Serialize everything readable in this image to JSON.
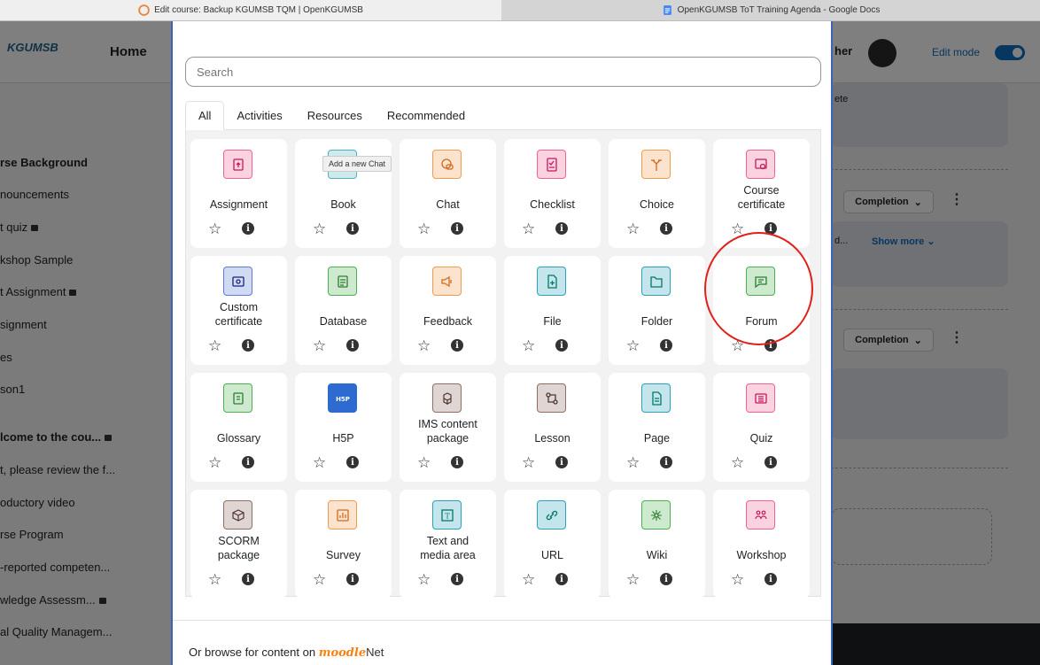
{
  "browser": {
    "tab1_title": "Edit course: Backup KGUMSB TQM | OpenKGUMSB",
    "tab2_title": "OpenKGUMSB ToT Training Agenda - Google Docs"
  },
  "navbar": {
    "logo": "KGUMSB",
    "home": "Home",
    "user_fragment": "her",
    "edit_mode_label": "Edit mode"
  },
  "sidebar": {
    "items": [
      "rse Background",
      "nouncements",
      "t quiz",
      "kshop Sample",
      "t Assignment",
      "signment",
      "es",
      "son1",
      "lcome to the cou...",
      "t, please review the f...",
      "oductory video",
      "rse Program",
      "-reported competen...",
      "wledge Assessm...",
      "al Quality Managem..."
    ]
  },
  "right": {
    "box1_text": "ete",
    "completion_label": "Completion",
    "truncated": "d...",
    "show_more": "Show more"
  },
  "modal": {
    "search_placeholder": "Search",
    "tabs": [
      "All",
      "Activities",
      "Resources",
      "Recommended"
    ],
    "tooltip": "Add a new Chat",
    "footer_text": "Or browse for content on",
    "moodle": "moodle",
    "net": "Net",
    "activities": [
      {
        "name": "Assignment",
        "icon": "assignment-icon",
        "color": "#f06292"
      },
      {
        "name": "Book",
        "icon": "book-icon",
        "color": "#4fb3bf"
      },
      {
        "name": "Chat",
        "icon": "chat-icon",
        "color": "#f29b4b"
      },
      {
        "name": "Checklist",
        "icon": "checklist-icon",
        "color": "#f06292"
      },
      {
        "name": "Choice",
        "icon": "choice-icon",
        "color": "#f29b4b"
      },
      {
        "name": "Course certificate",
        "icon": "certificate-icon",
        "color": "#f06292"
      },
      {
        "name": "Custom certificate",
        "icon": "custom-certificate-icon",
        "color": "#5b7bd5"
      },
      {
        "name": "Database",
        "icon": "database-icon",
        "color": "#4caf50"
      },
      {
        "name": "Feedback",
        "icon": "feedback-icon",
        "color": "#f29b4b"
      },
      {
        "name": "File",
        "icon": "file-icon",
        "color": "#29a3b8"
      },
      {
        "name": "Folder",
        "icon": "folder-icon",
        "color": "#29a3b8"
      },
      {
        "name": "Forum",
        "icon": "forum-icon",
        "color": "#4caf50"
      },
      {
        "name": "Glossary",
        "icon": "glossary-icon",
        "color": "#4caf50"
      },
      {
        "name": "H5P",
        "icon": "h5p-icon",
        "color": "#2e6bd1"
      },
      {
        "name": "IMS content package",
        "icon": "ims-package-icon",
        "color": "#8d6e63"
      },
      {
        "name": "Lesson",
        "icon": "lesson-icon",
        "color": "#8d6e63"
      },
      {
        "name": "Page",
        "icon": "page-icon",
        "color": "#29a3b8"
      },
      {
        "name": "Quiz",
        "icon": "quiz-icon",
        "color": "#f06292"
      },
      {
        "name": "SCORM package",
        "icon": "scorm-icon",
        "color": "#8d6e63"
      },
      {
        "name": "Survey",
        "icon": "survey-icon",
        "color": "#f29b4b"
      },
      {
        "name": "Text and media area",
        "icon": "text-media-icon",
        "color": "#29a3b8"
      },
      {
        "name": "URL",
        "icon": "url-icon",
        "color": "#29a3b8"
      },
      {
        "name": "Wiki",
        "icon": "wiki-icon",
        "color": "#4caf50"
      },
      {
        "name": "Workshop",
        "icon": "workshop-icon",
        "color": "#f06292"
      }
    ]
  }
}
